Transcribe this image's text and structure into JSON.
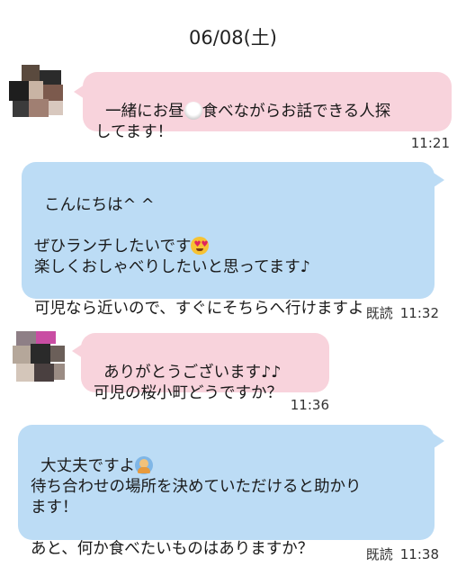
{
  "date": "06/08(土)",
  "messages": [
    {
      "text_a": "一緒にお昼",
      "emoji": "rice-bowl-icon",
      "text_b": "食べながらお話できる人探\nしてます！",
      "time": "11:21"
    },
    {
      "lines": "こんにちは^ ^\n\nぜひランチしたいです",
      "emoji": "heart-eyes-icon",
      "lines_b": "\n楽しくおしゃべりしたいと思ってます♪\n\n可児なら近いので、すぐにそちらへ行けますよ",
      "read": "既読",
      "time": "11:32"
    },
    {
      "text": "ありがとうございます♪♪\n可児の桜小町どうですか？",
      "time": "11:36"
    },
    {
      "text_a": "大丈夫ですよ",
      "emoji": "person-bowing-icon",
      "text_b": "\n待ち合わせの場所を決めていただけると助かり\nます！\n\nあと、何か食べたいものはありますか？",
      "read": "既読",
      "time": "11:38"
    }
  ],
  "colors": {
    "incoming": "#f8d3dc",
    "outgoing": "#bcdcf5"
  }
}
